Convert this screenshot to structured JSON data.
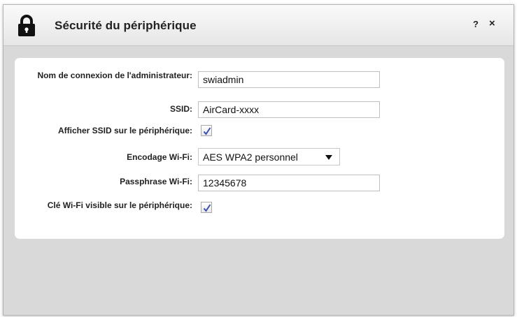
{
  "dialog": {
    "title": "Sécurité du périphérique",
    "help_label": "?",
    "close_label": "×"
  },
  "form": {
    "admin_login": {
      "label": "Nom de connexion de l'administrateur:",
      "value": "swiadmin"
    },
    "ssid": {
      "label": "SSID:",
      "value": "AirCard-xxxx"
    },
    "show_ssid": {
      "label": "Afficher SSID sur le périphérique:",
      "checked": true
    },
    "wifi_encoding": {
      "label": "Encodage Wi-Fi:",
      "value": "AES WPA2 personnel"
    },
    "wifi_passphrase": {
      "label": "Passphrase Wi-Fi:",
      "value": "12345678"
    },
    "wifi_key_visible": {
      "label": "Clé Wi-Fi visible sur le périphérique:",
      "checked": true
    }
  },
  "icons": {
    "lock": "lock-icon",
    "help": "help-icon",
    "close": "close-icon",
    "check": "check-icon",
    "dropdown": "caret-down-icon"
  },
  "colors": {
    "panel_background": "#d9d9d9",
    "checkmark": "#3a4fb0"
  }
}
